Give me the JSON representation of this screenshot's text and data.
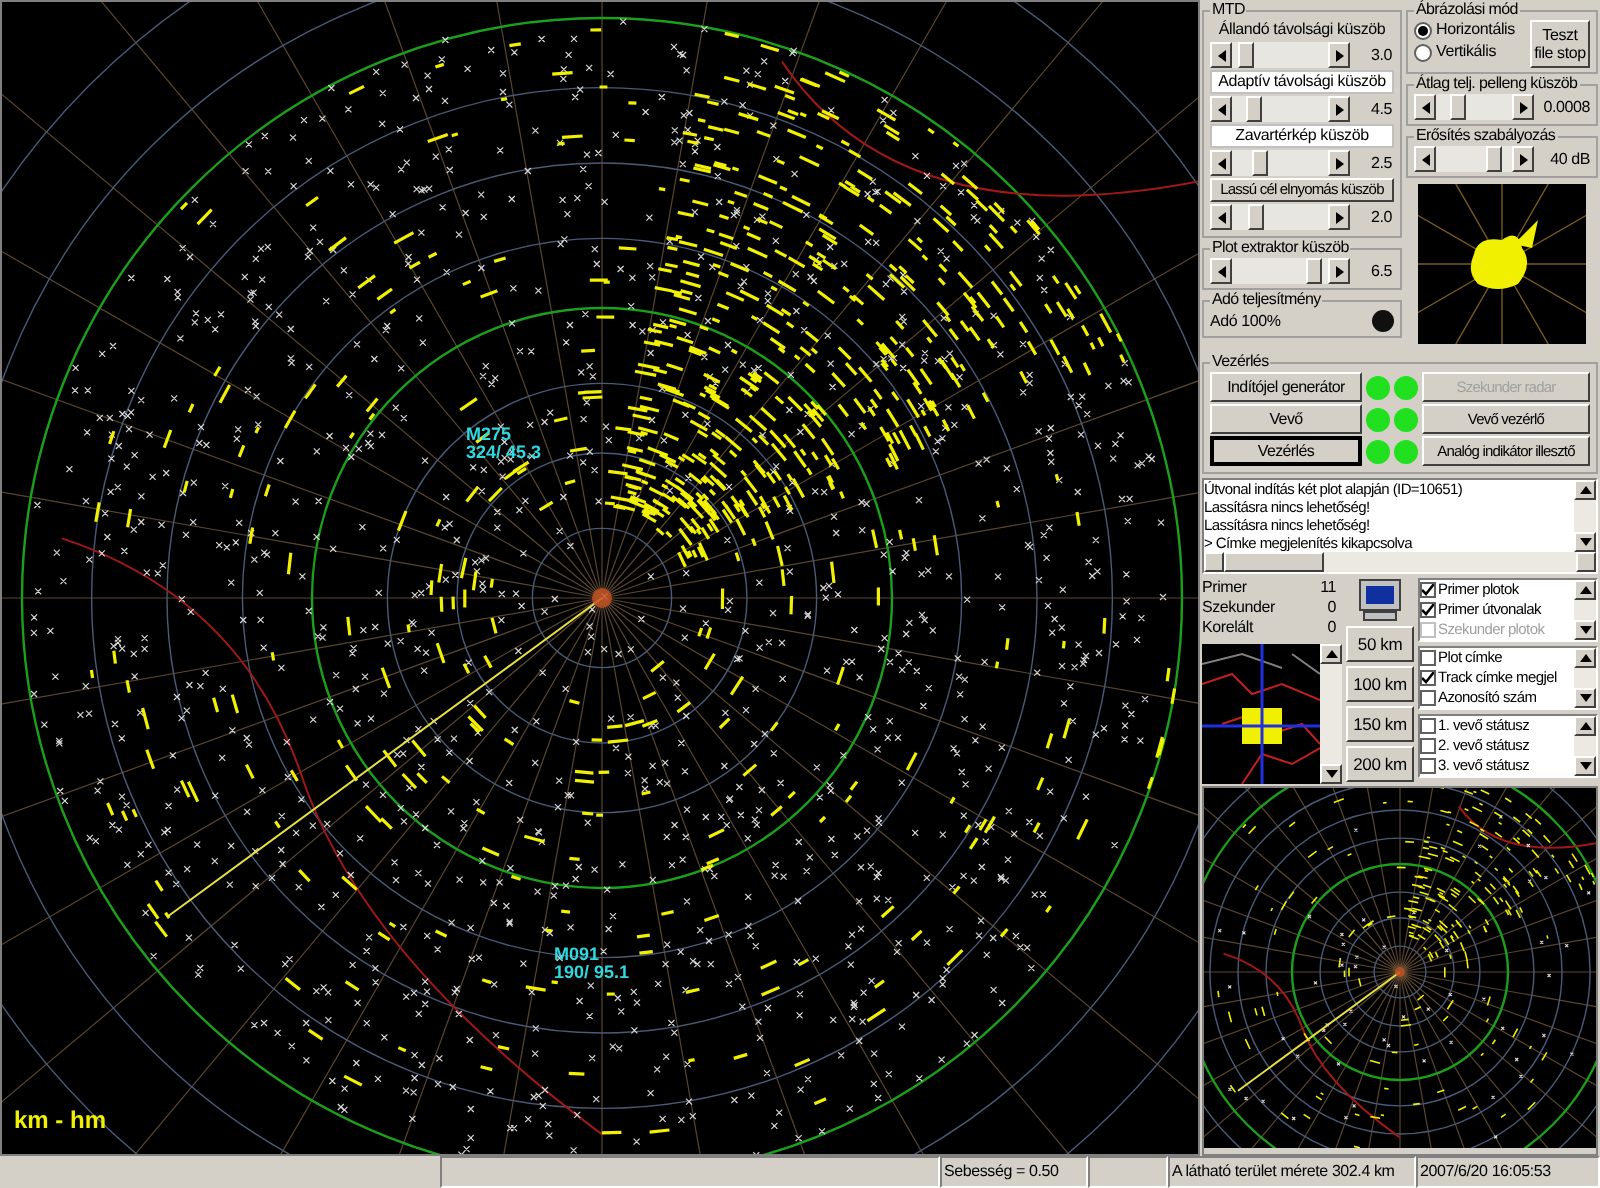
{
  "radar": {
    "unit_label": "km - hm",
    "tracks": [
      {
        "id": "M275",
        "reading": "324/ 45.3"
      },
      {
        "id": "M091",
        "reading": "190/ 95.1"
      }
    ]
  },
  "mtd": {
    "title": "MTD",
    "sliders": [
      {
        "label": "Állandó távolsági küszöb",
        "kind": "text",
        "level": 0.15,
        "reading": "3.0"
      },
      {
        "label": "Adaptív távolsági küszöb",
        "kind": "box",
        "level": 0.22,
        "reading": "4.5"
      },
      {
        "label": "Zavartérkép küszöb",
        "kind": "box",
        "level": 0.3,
        "reading": "2.5"
      },
      {
        "label": "Lassú cél elnyomás küszöb",
        "kind": "button",
        "level": 0.25,
        "reading": "2.0"
      }
    ]
  },
  "plot_extractor": {
    "title": "Plot extraktor küszöb",
    "level": 0.85,
    "reading": "6.5"
  },
  "transmitter": {
    "title": "Adó teljesítmény",
    "label": "Adó 100%",
    "on": false
  },
  "display_mode": {
    "title": "Ábrázolási mód",
    "options": [
      {
        "label": "Horizontális",
        "selected": true
      },
      {
        "label": "Vertikális",
        "selected": false
      }
    ],
    "button": "Teszt file stop"
  },
  "bearing_threshold": {
    "title": "Átlag telj. pelleng küszöb",
    "level": 0.3,
    "reading": "0.0008"
  },
  "gain": {
    "title": "Erősítés szabályozás",
    "level": 0.75,
    "reading": "40 dB"
  },
  "control": {
    "title": "Vezérlés",
    "rows": [
      {
        "left": {
          "label": "Indítójel generátor",
          "pressed": false
        },
        "led_left": true,
        "led_right": true,
        "right": {
          "label": "Szekunder radar",
          "disabled": true
        }
      },
      {
        "left": {
          "label": "Vevő",
          "pressed": false
        },
        "led_left": true,
        "led_right": true,
        "right": {
          "label": "Vevő vezérlő",
          "disabled": false
        }
      },
      {
        "left": {
          "label": "Vezérlés",
          "pressed": true
        },
        "led_left": true,
        "led_right": true,
        "right": {
          "label": "Analóg indikátor illesztő",
          "disabled": false
        }
      }
    ]
  },
  "log": [
    "Útvonal indítás két plot alapján (ID=10651)",
    "Lassításra nincs lehetőség!",
    "Lassításra nincs lehetőség!",
    "> Címke megjelenítés kikapcsolva"
  ],
  "counts": [
    {
      "label": "Primer",
      "value": "11"
    },
    {
      "label": "Szekunder",
      "value": "0"
    },
    {
      "label": "Korelált",
      "value": "0"
    }
  ],
  "range_buttons": [
    "50 km",
    "100 km",
    "150 km",
    "200 km"
  ],
  "option_lists": [
    [
      {
        "label": "Primer plotok",
        "checked": true,
        "disabled": false
      },
      {
        "label": "Primer útvonalak",
        "checked": true,
        "disabled": false
      },
      {
        "label": "Szekunder plotok",
        "checked": false,
        "disabled": true
      }
    ],
    [
      {
        "label": "Plot címke",
        "checked": false,
        "disabled": false
      },
      {
        "label": "Track címke megjel",
        "checked": true,
        "disabled": false
      },
      {
        "label": "Azonosító szám",
        "checked": false,
        "disabled": false
      }
    ],
    [
      {
        "label": "1. vevő státusz",
        "checked": false,
        "disabled": false
      },
      {
        "label": "2. vevő státusz",
        "checked": false,
        "disabled": false
      },
      {
        "label": "3. vevő státusz",
        "checked": false,
        "disabled": false
      }
    ]
  ],
  "status_bar": {
    "speed": "Sebesség = 0.50",
    "area": "A látható terület mérete 302.4 km",
    "datetime": "2007/6/20 16:05:53"
  }
}
